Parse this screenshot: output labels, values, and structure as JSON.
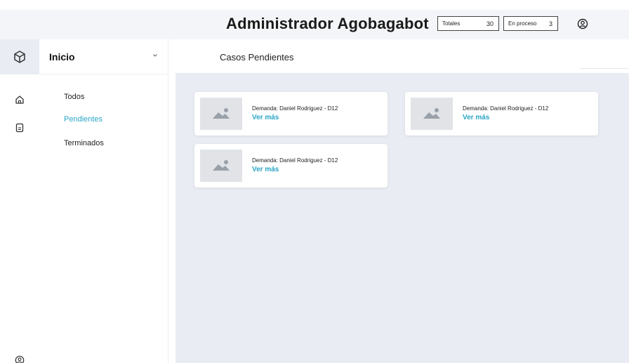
{
  "header": {
    "title": "Administrador Agobagabot",
    "stats": [
      {
        "label": "Totales",
        "value": "30"
      },
      {
        "label": "En proceso",
        "value": "3"
      }
    ]
  },
  "sidebar": {
    "section_title": "Inicio",
    "items": [
      {
        "label": "Todos",
        "active": false
      },
      {
        "label": "Pendientes",
        "active": true
      },
      {
        "label": "Terminados",
        "active": false
      }
    ]
  },
  "main": {
    "title": "Casos Pendientes",
    "cards": [
      {
        "title": "Demanda: Daniel Rodriguez - D12",
        "link": "Ver más"
      },
      {
        "title": "Demanda: Daniel Rodriguez - D12",
        "link": "Ver más"
      },
      {
        "title": "Demanda: Daniel Rodriguez - D12",
        "link": "Ver más"
      }
    ]
  },
  "colors": {
    "accent": "#2aa6c6",
    "content_background": "#e9ecf3",
    "topbar_background": "#f4f5f8"
  },
  "icons": {
    "logo": "cube-icon",
    "rail": [
      "home-icon",
      "document-icon",
      "user-circle-icon"
    ],
    "header_user": "user-circle-icon",
    "card_thumb": "image-placeholder-icon"
  }
}
